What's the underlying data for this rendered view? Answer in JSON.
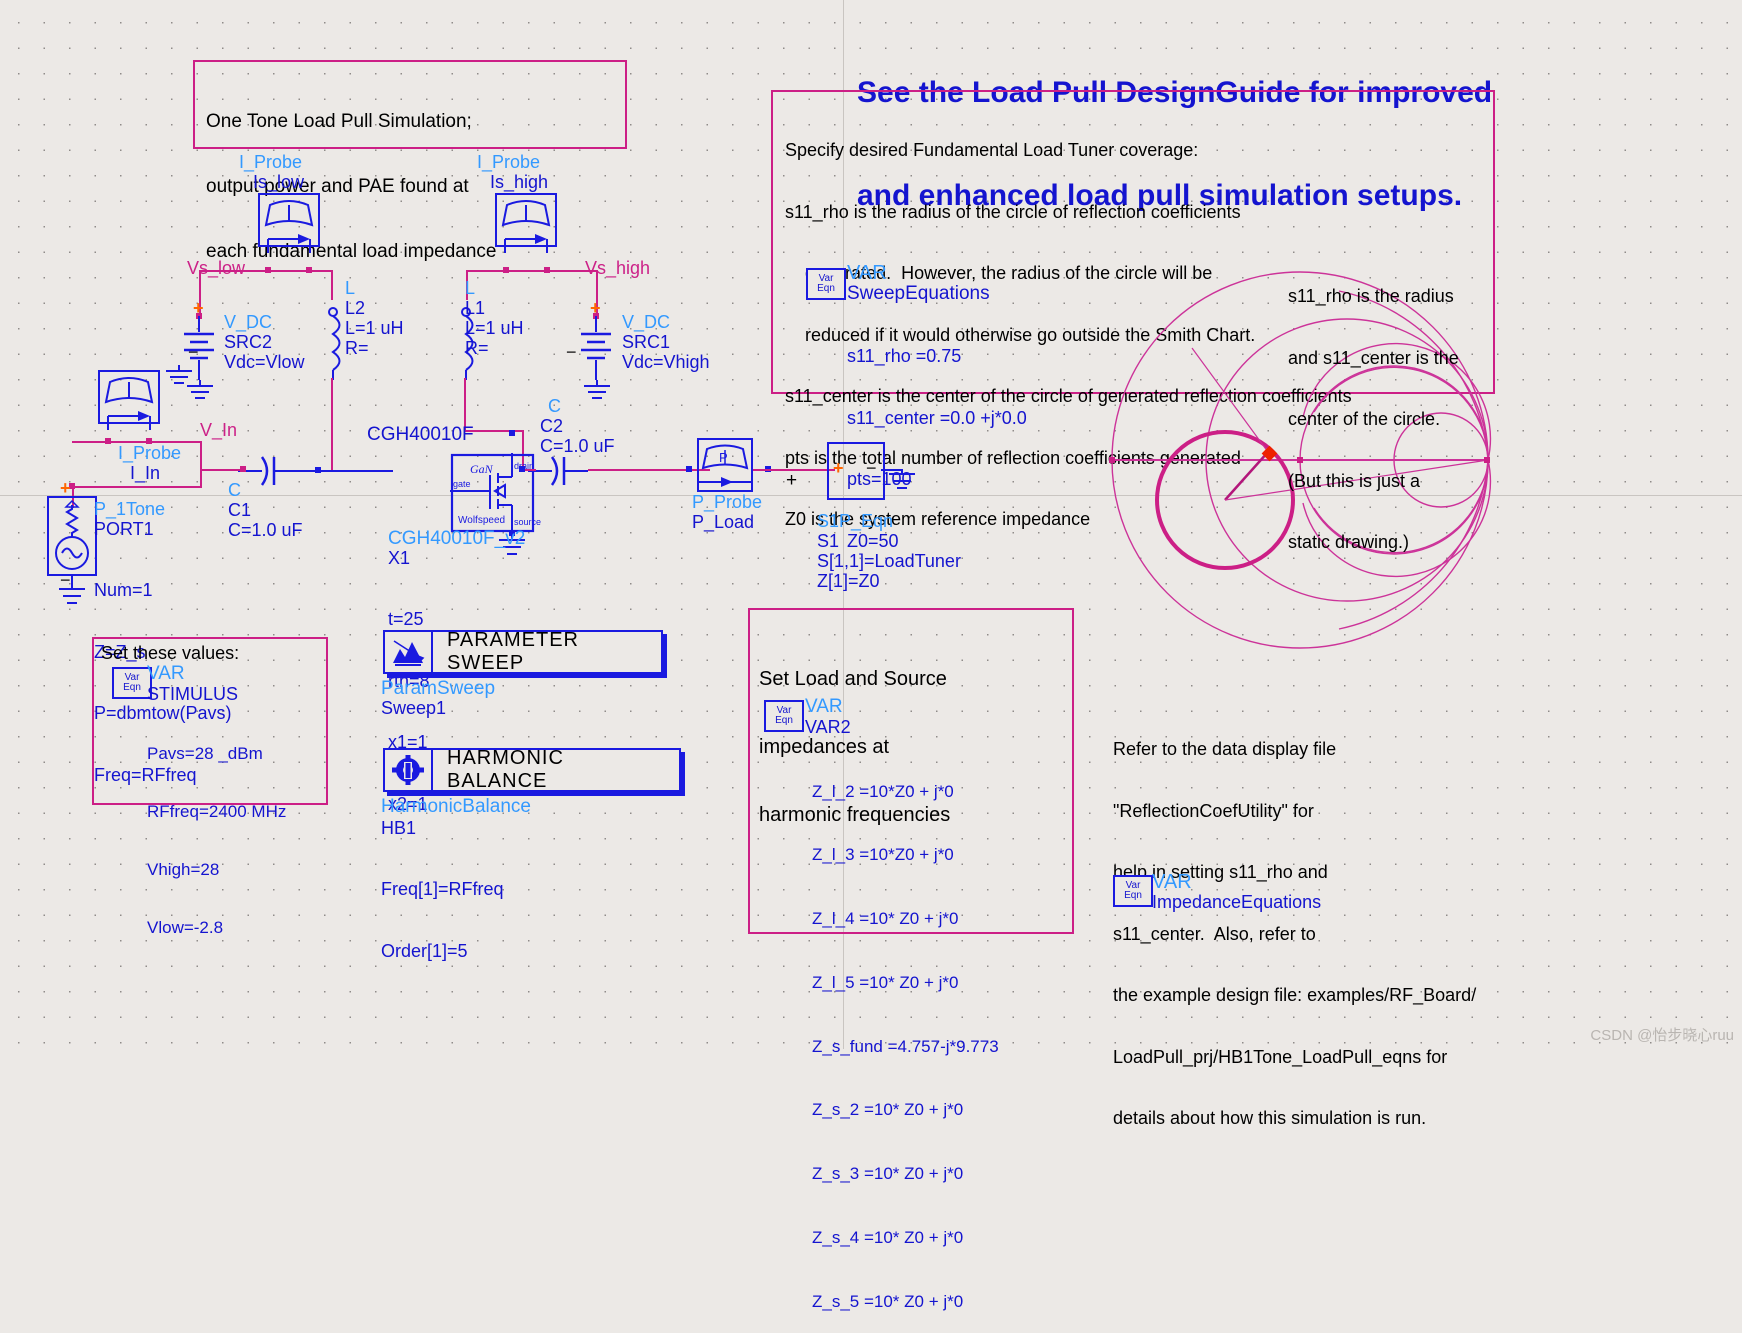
{
  "header": {
    "banner_line1": "See the Load Pull DesignGuide for improved",
    "banner_line2": "and enhanced load pull simulation setups."
  },
  "notes": {
    "title_note": {
      "line1": "One Tone Load Pull Simulation;",
      "line2": "output power and PAE found at",
      "line3": "each fundamental load impedance"
    },
    "tuner_note": {
      "line1": "Specify desired Fundamental Load Tuner coverage:",
      "line2": "s11_rho is the radius of the circle of reflection coefficients",
      "line3": "    generated.  However, the radius of the circle will be",
      "line4": "    reduced if it would otherwise go outside the Smith Chart.",
      "line5": "s11_center is the center of the circle of generated reflection coefficients",
      "line6": "pts is the total number of reflection coefficients generated",
      "line7": "Z0 is the system reference impedance"
    },
    "smith_note": {
      "line1": "s11_rho is the radius",
      "line2": "and s11_center is the",
      "line3": "center of the circle.",
      "line4": "(But this is just a",
      "line5": "static drawing.)"
    },
    "harmonic_note": {
      "line1": "Set Load and Source",
      "line2": "impedances at",
      "line3": "harmonic frequencies"
    },
    "set_values_note": "Set these values:",
    "refer_note": {
      "line1": "Refer to the data display file",
      "line2": "\"ReflectionCoefUtility\" for",
      "line3": "help in setting s11_rho and",
      "line4": "s11_center.  Also, refer to",
      "line5": "the example design file: examples/RF_Board/",
      "line6": "LoadPull_prj/HB1Tone_LoadPull_eqns for",
      "line7": "details about how this simulation is run."
    }
  },
  "var_blocks": {
    "sweep_equations": {
      "icon_top": "Var",
      "icon_bottom": "Eqn",
      "type": "VAR",
      "name": "SweepEquations",
      "params": [
        "s11_rho =0.75",
        "s11_center =0.0 +j*0.0",
        "pts=100",
        "Z0=50"
      ]
    },
    "stimulus": {
      "icon_top": "Var",
      "icon_bottom": "Eqn",
      "type": "VAR",
      "name": "STIMULUS",
      "params": [
        "Pavs=28 _dBm",
        "RFfreq=2400 MHz",
        "Vhigh=28",
        "Vlow=-2.8"
      ]
    },
    "var2": {
      "icon_top": "Var",
      "icon_bottom": "Eqn",
      "type": "VAR",
      "name": "VAR2",
      "params": [
        "Z_l_2 =10*Z0 + j*0",
        "Z_l_3 =10*Z0 + j*0",
        "Z_l_4 =10* Z0 + j*0",
        "Z_l_5 =10* Z0 + j*0",
        "Z_s_fund =4.757-j*9.773",
        "Z_s_2 =10* Z0 + j*0",
        "Z_s_3 =10* Z0 + j*0",
        "Z_s_4 =10* Z0 + j*0",
        "Z_s_5 =10* Z0 + j*0"
      ]
    },
    "impedance_equations": {
      "icon_top": "Var",
      "icon_bottom": "Eqn",
      "type": "VAR",
      "name": "ImpedanceEquations"
    }
  },
  "components": {
    "iprobe_low": {
      "type": "I_Probe",
      "name": "Is_low"
    },
    "iprobe_high": {
      "type": "I_Probe",
      "name": "Is_high"
    },
    "iprobe_in": {
      "type": "I_Probe",
      "name": "I_In"
    },
    "src2": {
      "type": "V_DC",
      "name": "SRC2",
      "param": "Vdc=Vlow"
    },
    "src1": {
      "type": "V_DC",
      "name": "SRC1",
      "param": "Vdc=Vhigh"
    },
    "l2": {
      "type": "L",
      "name": "L2",
      "param1": "L=1 uH",
      "param2": "R="
    },
    "l1": {
      "type": "L",
      "name": "L1",
      "param1": "L=1 uH",
      "param2": "R="
    },
    "c1": {
      "type": "C",
      "name": "C1",
      "param": "C=1.0 uF"
    },
    "c2": {
      "type": "C",
      "name": "C2",
      "param": "C=1.0 uF"
    },
    "fet": {
      "part_label": "CGH40010F",
      "tech": "GaN",
      "vendor": "Wolfspeed",
      "pin_gate": "gate",
      "pin_drain": "drain",
      "pin_source": "source",
      "model": "CGH40010F_v2",
      "name": "X1",
      "params": [
        "t=25",
        "rth=8",
        "x1=1",
        "x2=1"
      ]
    },
    "p_probe": {
      "type": "P_Probe",
      "name": "P_Load",
      "meter_glyph": "P"
    },
    "s1p": {
      "type": "S1P_Eqn",
      "name": "S1",
      "param1": "S[1,1]=LoadTuner",
      "param2": "Z[1]=Z0",
      "plus": "+",
      "minus": "−"
    },
    "port1": {
      "type": "P_1Tone",
      "name": "PORT1",
      "params": [
        "Num=1",
        "Z=Z_s",
        "P=dbmtow(Pavs)",
        "Freq=RFfreq"
      ],
      "plus": "+",
      "minus": "−"
    }
  },
  "net_labels": {
    "vs_low": "Vs_low",
    "vs_high": "Vs_high",
    "v_in": "V_In"
  },
  "sim_controllers": {
    "param_sweep": {
      "button_label": "PARAMETER SWEEP",
      "type": "ParamSweep",
      "name": "Sweep1",
      "icon": "param-sweep-icon"
    },
    "harmonic_balance": {
      "button_label": "HARMONIC BALANCE",
      "type": "HarmonicBalance",
      "name": "HB1",
      "params": [
        "Freq[1]=RFfreq",
        "Order[1]=5"
      ],
      "icon": "harmonic-balance-icon"
    }
  },
  "watermark": "CSDN @怡步晓心ruu",
  "colors": {
    "magenta": "#cc1f86",
    "blue": "#1414cf",
    "cyan": "#3399ff",
    "background": "#ece9e6",
    "smith_chart": "#cc3399",
    "marker_red": "#ee2200"
  }
}
